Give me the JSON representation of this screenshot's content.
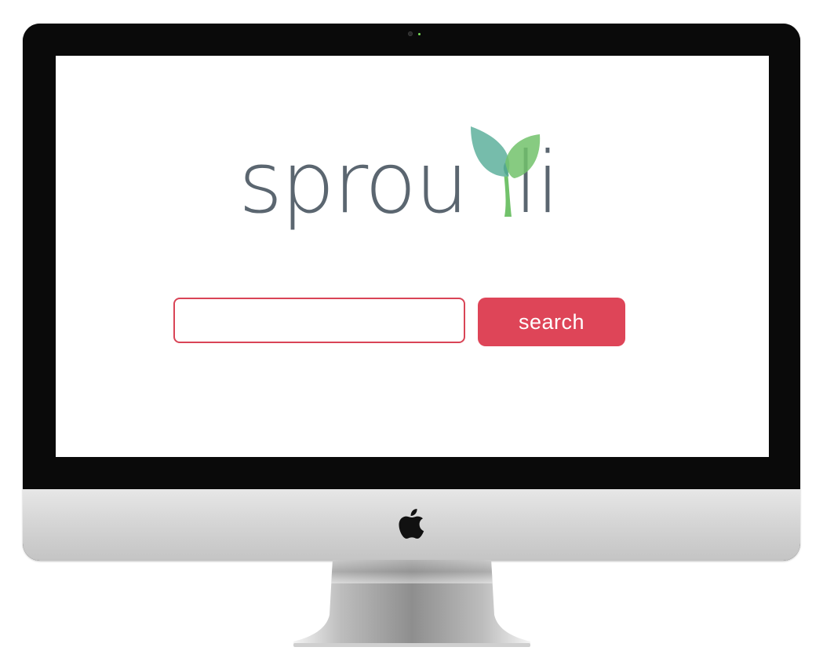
{
  "brand": {
    "name_part_1": "sprou",
    "name_part_2": "li",
    "text_color": "#5b6670",
    "leaf_colors": [
      "#6fb8a6",
      "#72c26b"
    ]
  },
  "search": {
    "value": "",
    "placeholder": "",
    "button_label": "search",
    "accent_color": "#de4558"
  },
  "device": {
    "logo": "apple-icon"
  }
}
